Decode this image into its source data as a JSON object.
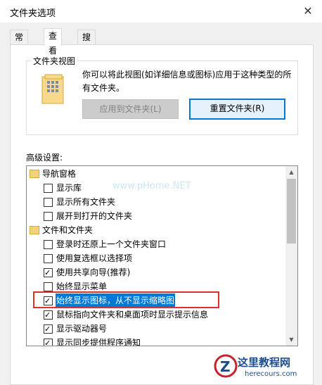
{
  "window": {
    "title": "文件夹选项",
    "close_glyph": "✕"
  },
  "tabs": [
    {
      "label": "常规"
    },
    {
      "label": "查看"
    },
    {
      "label": "搜索"
    }
  ],
  "folder_views": {
    "group_label": "文件夹视图",
    "description": "你可以将此视图(如详细信息或图标)应用于这种类型的所有文件夹。",
    "apply_button": "应用到文件夹(L)",
    "reset_button": "重置文件夹(R)"
  },
  "advanced": {
    "label": "高级设置:",
    "items": [
      {
        "type": "folder",
        "label": "导航窗格"
      },
      {
        "type": "checkbox",
        "label": "显示库",
        "checked": false
      },
      {
        "type": "checkbox",
        "label": "显示所有文件夹",
        "checked": false
      },
      {
        "type": "checkbox",
        "label": "展开到打开的文件夹",
        "checked": false
      },
      {
        "type": "folder",
        "label": "文件和文件夹"
      },
      {
        "type": "checkbox",
        "label": "登录时还原上一个文件夹窗口",
        "checked": false
      },
      {
        "type": "checkbox",
        "label": "使用复选框以选择项",
        "checked": false
      },
      {
        "type": "checkbox",
        "label": "使用共享向导(推荐)",
        "checked": true
      },
      {
        "type": "checkbox",
        "label": "始终显示菜单",
        "checked": false
      },
      {
        "type": "checkbox",
        "label": "始终显示图标，从不显示缩略图",
        "checked": true
      },
      {
        "type": "checkbox",
        "label": "鼠标指向文件夹和桌面项时显示提示信息",
        "checked": true
      },
      {
        "type": "checkbox",
        "label": "显示驱动器号",
        "checked": true
      },
      {
        "type": "checkbox",
        "label": "显示同步提供程序通知",
        "checked": true
      }
    ]
  },
  "watermark": {
    "name": "这里教程网",
    "url": "herecours.com"
  },
  "faint_watermark": "www.pHome.NET",
  "colors": {
    "highlight": "#e0302a",
    "selection": "#0078d7",
    "accent": "#0078d7"
  }
}
